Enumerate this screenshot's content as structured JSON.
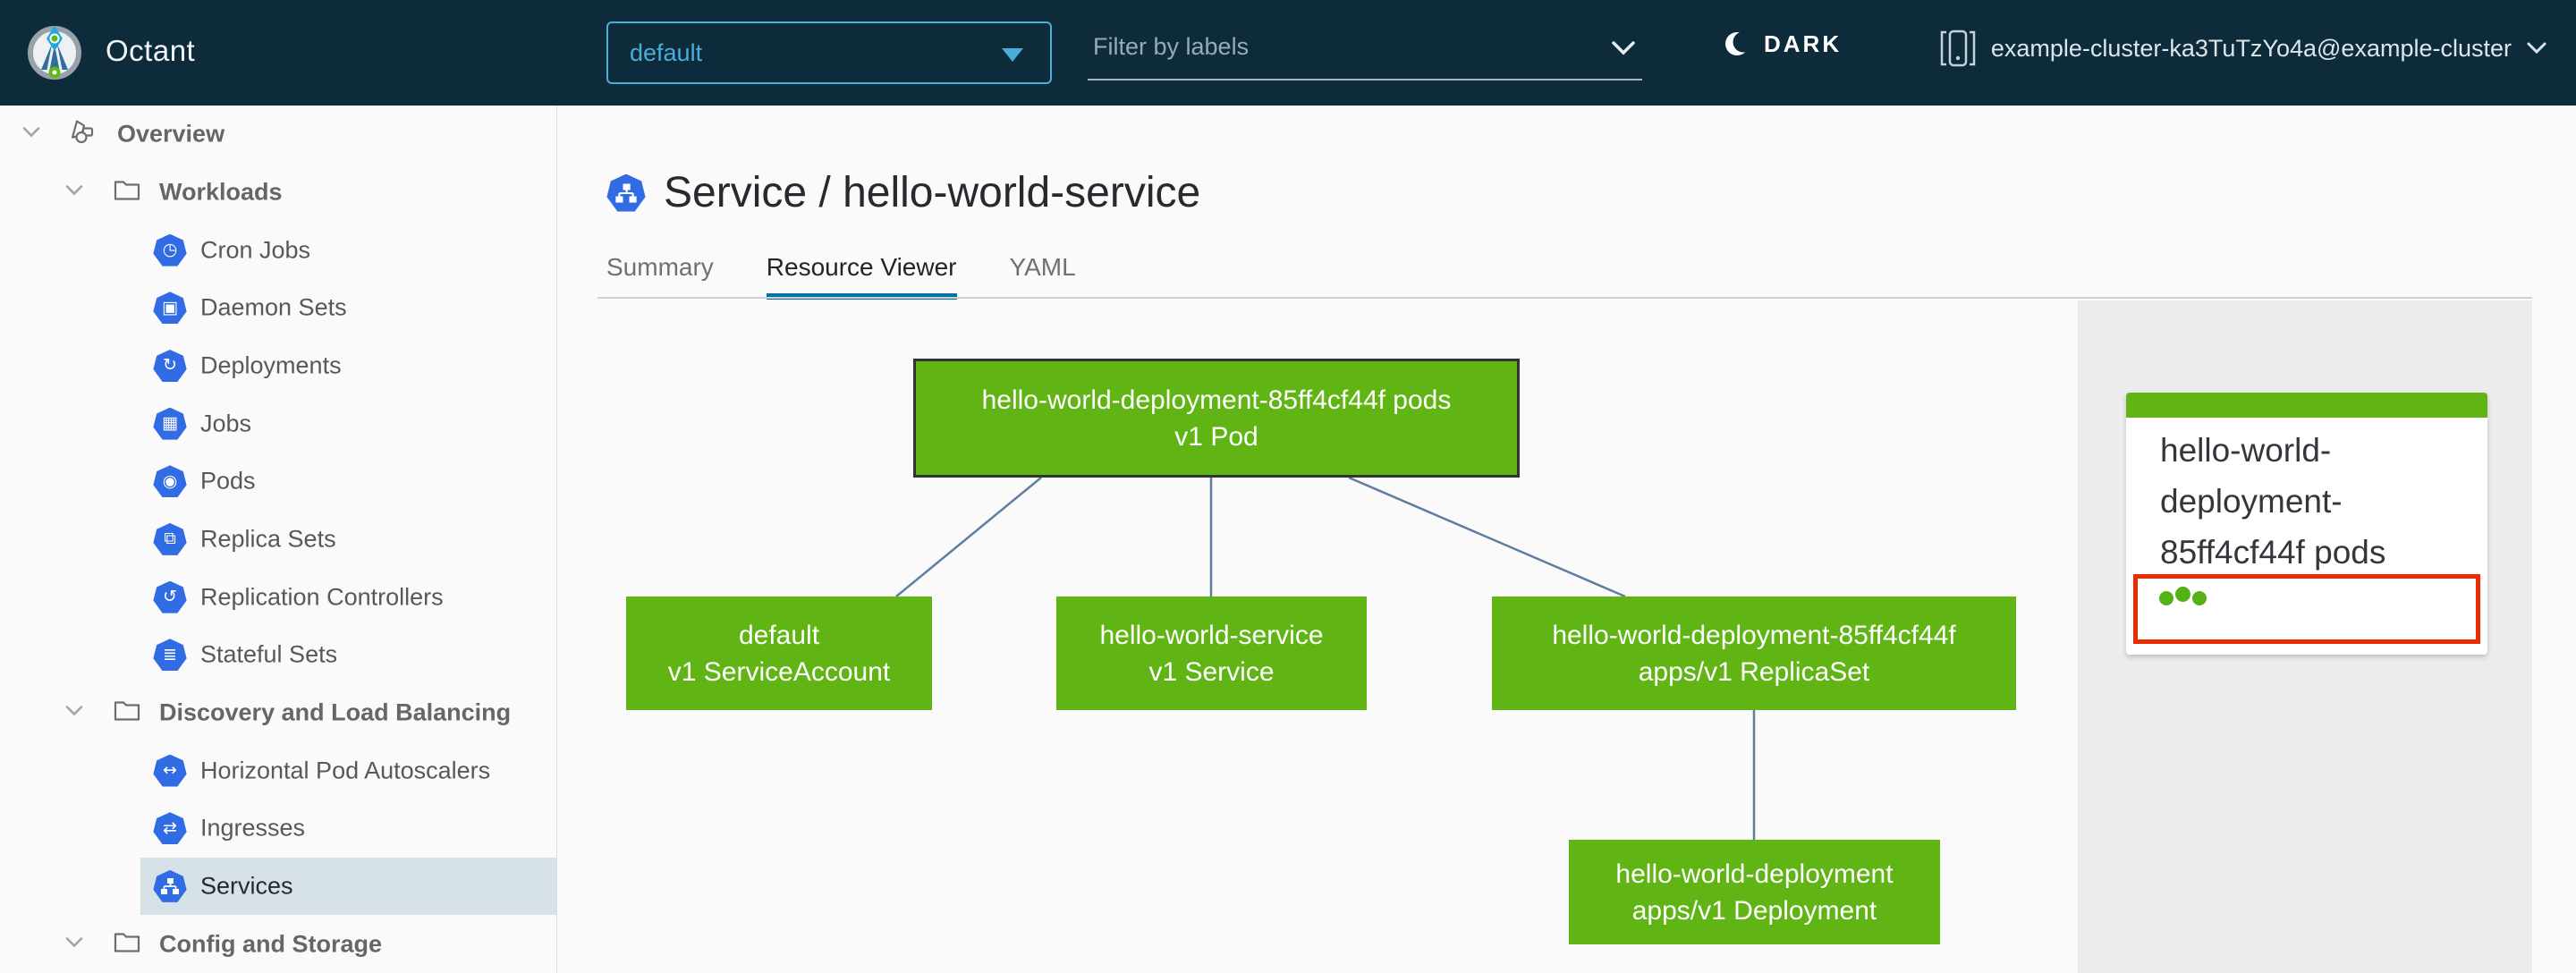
{
  "header": {
    "app_title": "Octant",
    "namespace_selector": {
      "value": "default"
    },
    "label_filter": {
      "placeholder": "Filter by labels"
    },
    "theme_toggle": {
      "label": "DARK"
    },
    "context_selector": {
      "value": "example-cluster-ka3TuTzYo4a@example-cluster"
    }
  },
  "sidebar": {
    "items": [
      {
        "label": "Overview",
        "level": 0,
        "icon": "objects",
        "selected": false
      },
      {
        "label": "Workloads",
        "level": 1,
        "icon": "folder",
        "selected": false
      },
      {
        "label": "Cron Jobs",
        "level": 2,
        "icon": "cronjobs",
        "selected": false
      },
      {
        "label": "Daemon Sets",
        "level": 2,
        "icon": "daemonsets",
        "selected": false
      },
      {
        "label": "Deployments",
        "level": 2,
        "icon": "deployments",
        "selected": false
      },
      {
        "label": "Jobs",
        "level": 2,
        "icon": "jobs",
        "selected": false
      },
      {
        "label": "Pods",
        "level": 2,
        "icon": "pods",
        "selected": false
      },
      {
        "label": "Replica Sets",
        "level": 2,
        "icon": "replicasets",
        "selected": false
      },
      {
        "label": "Replication Controllers",
        "level": 2,
        "icon": "replicationcontrollers",
        "selected": false
      },
      {
        "label": "Stateful Sets",
        "level": 2,
        "icon": "statefulsets",
        "selected": false
      },
      {
        "label": "Discovery and Load Balancing",
        "level": 1,
        "icon": "folder",
        "selected": false
      },
      {
        "label": "Horizontal Pod Autoscalers",
        "level": 2,
        "icon": "hpa",
        "selected": false
      },
      {
        "label": "Ingresses",
        "level": 2,
        "icon": "ingresses",
        "selected": false
      },
      {
        "label": "Services",
        "level": 2,
        "icon": "services",
        "selected": true
      },
      {
        "label": "Config and Storage",
        "level": 1,
        "icon": "folder",
        "selected": false
      }
    ]
  },
  "main": {
    "page_title": "Service / hello-world-service",
    "tabs": [
      {
        "label": "Summary",
        "active": false
      },
      {
        "label": "Resource Viewer",
        "active": true
      },
      {
        "label": "YAML",
        "active": false
      }
    ]
  },
  "graph": {
    "nodes": {
      "pod": {
        "name": "hello-world-deployment-85ff4cf44f pods",
        "kind": "v1 Pod"
      },
      "serviceaccount": {
        "name": "default",
        "kind": "v1 ServiceAccount"
      },
      "service": {
        "name": "hello-world-service",
        "kind": "v1 Service"
      },
      "replicaset": {
        "name": "hello-world-deployment-85ff4cf44f",
        "kind": "apps/v1 ReplicaSet"
      },
      "deployment": {
        "name": "hello-world-deployment",
        "kind": "apps/v1 Deployment"
      }
    }
  },
  "detail_panel": {
    "card": {
      "title": "hello-world-deployment-85ff4cf44f pods",
      "pod_count": 3
    }
  },
  "icon_glyphs": {
    "cronjobs": "◷",
    "daemonsets": "▣",
    "deployments": "↻",
    "jobs": "▦",
    "pods": "◉",
    "replicasets": "⧉",
    "replicationcontrollers": "↺",
    "statefulsets": "≣",
    "hpa": "↔",
    "ingresses": "⇄"
  },
  "colors": {
    "header_bg": "#0D2B3A",
    "accent_blue": "#49AFD9",
    "k8s_blue": "#326CE5",
    "node_green": "#60B515",
    "highlight_red": "#ED2B00",
    "tab_underline": "#0072A3",
    "edge": "#5F7E9E",
    "selected_item_bg": "#D7E1E8",
    "panel_bg": "#ECECEC"
  }
}
